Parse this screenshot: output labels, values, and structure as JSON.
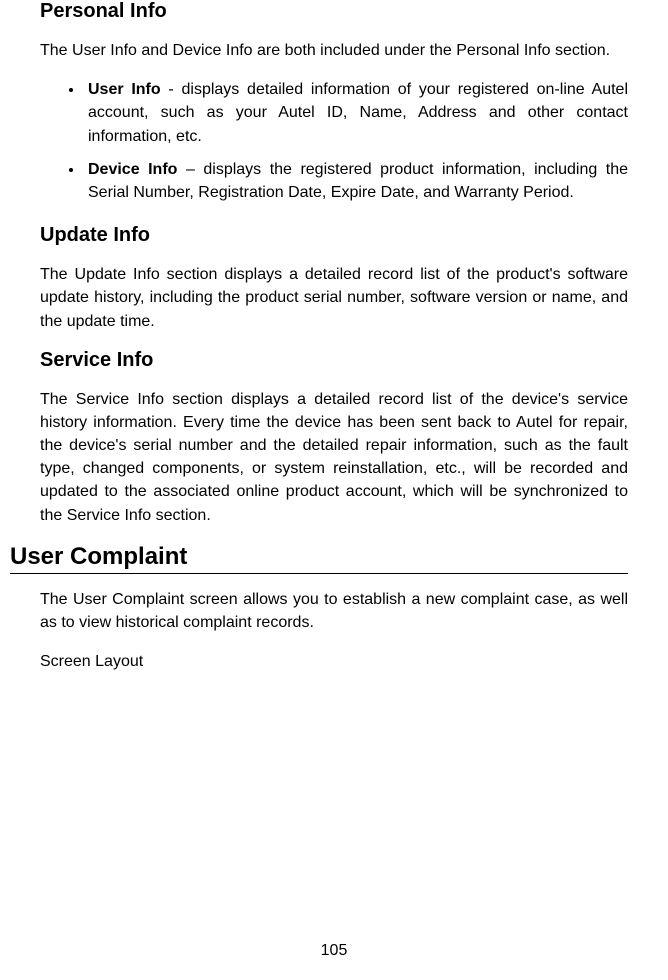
{
  "personal_info": {
    "heading": "Personal Info",
    "intro": "The User Info and Device Info are both included under the Personal Info section.",
    "items": [
      {
        "label": "User Info",
        "sep": " - ",
        "text": "displays detailed information of your registered on-line Autel account, such as your Autel ID, Name, Address and other contact information, etc."
      },
      {
        "label": "Device Info",
        "sep": " – ",
        "text": "displays the registered product information, including the Serial Number, Registration Date, Expire Date, and Warranty Period."
      }
    ]
  },
  "update_info": {
    "heading": "Update Info",
    "body": "The Update Info section displays a detailed record list of the product's software update history, including the product serial number, software version or name, and the update time."
  },
  "service_info": {
    "heading": "Service Info",
    "body": "The Service Info section displays a detailed record list of the device's service history information. Every time the device has been sent back to Autel for repair, the device's serial number and the detailed repair information, such as the fault type, changed components, or system reinstallation, etc., will be recorded and updated to the associated online product account, which will be synchronized to the Service Info section."
  },
  "user_complaint": {
    "heading": "User Complaint",
    "body": "The User Complaint screen allows you to establish a new complaint case, as well as to view historical complaint records.",
    "subhead": "Screen Layout"
  },
  "page_number": "105"
}
